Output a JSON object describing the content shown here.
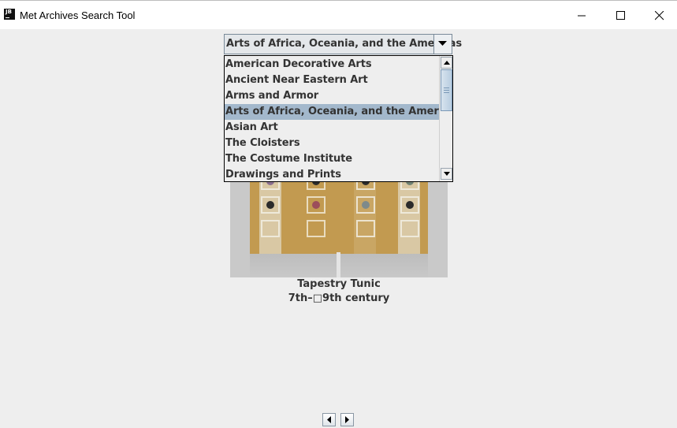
{
  "window": {
    "title": "Met Archives Search Tool",
    "app_icon_text": "JB"
  },
  "department_combo": {
    "selected": "Arts of Africa, Oceania, and the Americas",
    "options": [
      "American Decorative Arts",
      "Ancient Near Eastern Art",
      "Arms and Armor",
      "Arts of Africa, Oceania, and the Americas",
      "Asian Art",
      "The Cloisters",
      "The Costume Institute",
      "Drawings and Prints"
    ],
    "selected_index": 3
  },
  "artwork": {
    "title": "Tapestry Tunic",
    "date": "7th–□9th century"
  },
  "navigation": {
    "prev_icon": "left-arrow-icon",
    "next_icon": "right-arrow-icon"
  },
  "colors": {
    "selection": "#a3b8cc",
    "background": "#eeeeee"
  }
}
